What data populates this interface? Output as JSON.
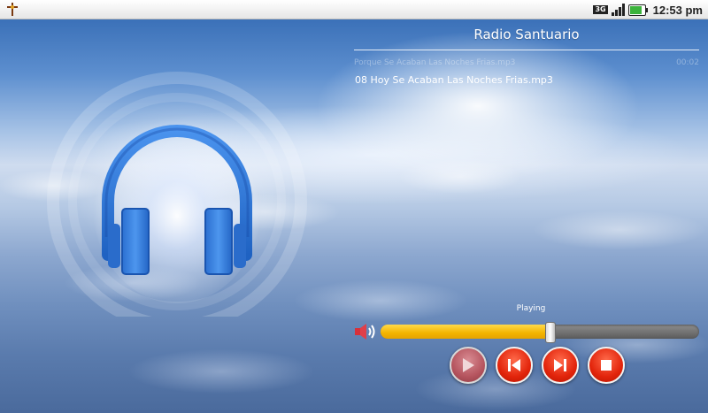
{
  "status_bar": {
    "network": "3G",
    "time": "12:53 pm"
  },
  "player": {
    "station_title": "Radio Santuario",
    "previous_track": "Porque Se Acaban Las Noches Frias.mp3",
    "previous_time": "00:02",
    "current_track": "08 Hoy Se Acaban Las Noches Frias.mp3",
    "status": "Playing",
    "progress": 0.53
  },
  "icons": {
    "app": "app-cross-icon",
    "artwork": "headphones-icon",
    "volume": "speaker-icon",
    "play": "play-icon",
    "previous": "skip-previous-icon",
    "next": "skip-next-icon",
    "stop": "stop-icon"
  },
  "colors": {
    "accent_red": "#e2240b",
    "seek_fill": "#f3b400",
    "headphone_blue": "#2f78d8"
  }
}
